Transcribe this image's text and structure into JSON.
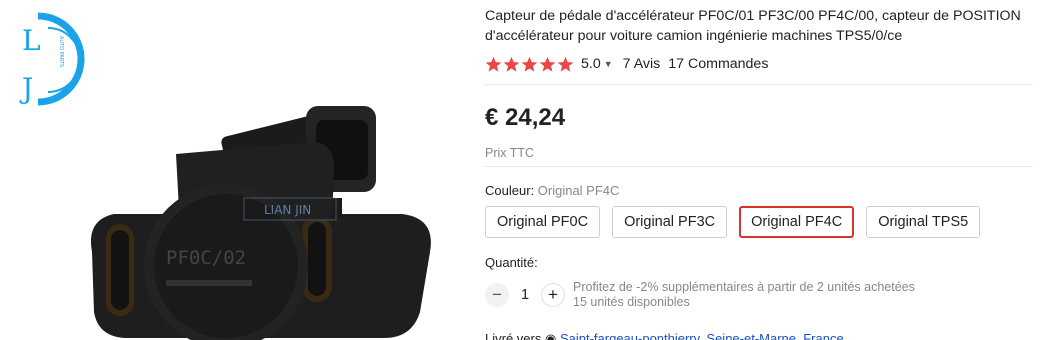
{
  "logo": {
    "letters": [
      "L",
      "J"
    ],
    "vertical_text": "AUTO PARTS"
  },
  "image": {
    "watermark": "LIAN JIN",
    "part_marking": "PF0C/02"
  },
  "product": {
    "title": "Capteur de pédale d'accélérateur PF0C/01 PF3C/00 PF4C/00, capteur de POSITION d'accélérateur pour voiture camion ingénierie machines TPS5/0/ce",
    "rating": "5.0",
    "stars": 5,
    "reviews": "7 Avis",
    "orders": "17 Commandes",
    "price": "€ 24,24",
    "tax_note": "Prix TTC"
  },
  "color": {
    "label": "Couleur:",
    "selected": "Original PF4C",
    "options": [
      "Original PF0C",
      "Original PF3C",
      "Original PF4C",
      "Original TPS5"
    ],
    "selected_index": 2
  },
  "quantity": {
    "label": "Quantité:",
    "minus": "−",
    "plus": "+",
    "value": "1",
    "promo": "Profitez de -2% supplémentaires à partir de 2 unités achetées",
    "available": "15 unités disponibles"
  },
  "delivery": {
    "label": "Livré vers",
    "location": "Saint-fargeau-ponthierry, Seine-et-Marne, France"
  },
  "colors": {
    "accent": "#d9342b",
    "star": "#e8474a",
    "link": "#1a4fbf",
    "logo_blue": "#1aa3e8"
  }
}
